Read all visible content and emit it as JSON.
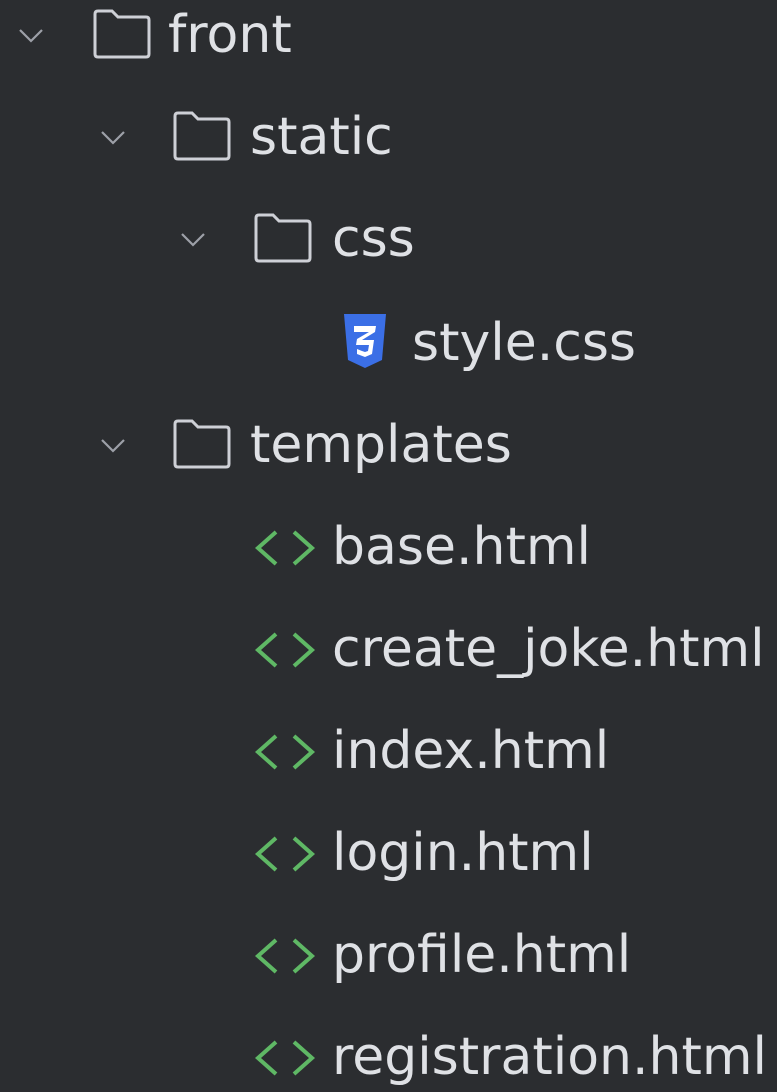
{
  "project_tree": {
    "front": {
      "label": "front",
      "expanded": true,
      "icon": "folder-icon"
    },
    "static": {
      "label": "static",
      "expanded": true,
      "icon": "folder-icon"
    },
    "css": {
      "label": "css",
      "expanded": true,
      "icon": "folder-icon"
    },
    "style_css": {
      "label": "style.css",
      "icon": "css-file-icon",
      "icon_color": "#3b6fe6"
    },
    "templates": {
      "label": "templates",
      "expanded": true,
      "icon": "folder-icon"
    },
    "files": [
      {
        "label": "base.html",
        "icon": "html-file-icon"
      },
      {
        "label": "create_joke.html",
        "icon": "html-file-icon"
      },
      {
        "label": "index.html",
        "icon": "html-file-icon"
      },
      {
        "label": "login.html",
        "icon": "html-file-icon"
      },
      {
        "label": "profile.html",
        "icon": "html-file-icon"
      },
      {
        "label": "registration.html",
        "icon": "html-file-icon"
      }
    ]
  },
  "colors": {
    "background": "#2b2d30",
    "text": "#dfe1e5",
    "folder_stroke": "#ced0d6",
    "chevron": "#9da0a8",
    "html_icon": "#5fb865",
    "css_icon": "#3b6fe6"
  }
}
